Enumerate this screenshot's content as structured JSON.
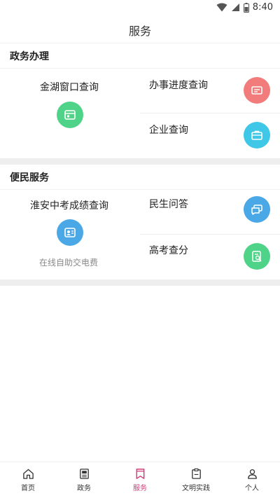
{
  "status_bar": {
    "time": "8:40"
  },
  "header": {
    "title": "服务"
  },
  "sections": [
    {
      "title": "政务办理",
      "left": {
        "label": "金湖窗口查询",
        "icon": "id-card-icon",
        "color": "#4fd389"
      },
      "right": [
        {
          "label": "办事进度查询",
          "icon": "card-icon",
          "color": "#f27c7c"
        },
        {
          "label": "企业查询",
          "icon": "briefcase-icon",
          "color": "#3ec7e6"
        }
      ]
    },
    {
      "title": "便民服务",
      "left": {
        "label": "淮安中考成绩查询",
        "icon": "photo-id-icon",
        "color": "#4aa8e6",
        "sub": "在线自助交电费"
      },
      "right": [
        {
          "label": "民生问答",
          "icon": "chat-icon",
          "color": "#4aa8e6"
        },
        {
          "label": "高考查分",
          "icon": "search-doc-icon",
          "color": "#4fd389"
        }
      ]
    }
  ],
  "nav": [
    {
      "label": "首页",
      "icon": "home-icon",
      "active": false
    },
    {
      "label": "政务",
      "icon": "document-icon",
      "active": false
    },
    {
      "label": "服务",
      "icon": "bookmark-icon",
      "active": true
    },
    {
      "label": "文明实践",
      "icon": "clipboard-icon",
      "active": false
    },
    {
      "label": "个人",
      "icon": "person-icon",
      "active": false
    }
  ],
  "colors": {
    "active": "#d4397a",
    "divider": "#eeeeee"
  }
}
